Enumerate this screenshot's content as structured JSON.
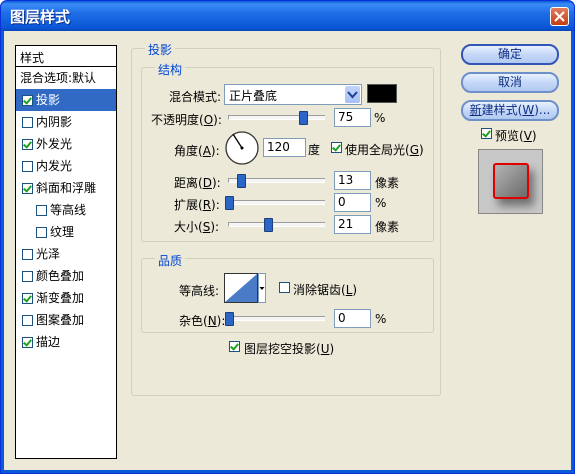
{
  "window": {
    "title": "图层样式"
  },
  "list": {
    "header": "样式",
    "blend_item": "混合选项:默认",
    "items": [
      {
        "label": "投影",
        "checked": true
      },
      {
        "label": "内阴影",
        "checked": false
      },
      {
        "label": "外发光",
        "checked": true
      },
      {
        "label": "内发光",
        "checked": false
      },
      {
        "label": "斜面和浮雕",
        "checked": true
      },
      {
        "label": "等高线",
        "checked": false
      },
      {
        "label": "纹理",
        "checked": false
      },
      {
        "label": "光泽",
        "checked": false
      },
      {
        "label": "颜色叠加",
        "checked": false
      },
      {
        "label": "渐变叠加",
        "checked": true
      },
      {
        "label": "图案叠加",
        "checked": false
      },
      {
        "label": "描边",
        "checked": true
      }
    ]
  },
  "drop_shadow": {
    "title": "投影",
    "structure": {
      "title": "结构",
      "blend_mode_label": "混合模式:",
      "blend_mode_value": "正片叠底",
      "blend_color": "#000000",
      "opacity_label": "不透明度(O):",
      "opacity_value": "75",
      "opacity_unit": "%",
      "opacity_level": 0.75,
      "angle_label": "角度(A):",
      "angle_value": "120",
      "angle_unit": "度",
      "global_light_label": "使用全局光(G)",
      "global_light_checked": true,
      "distance_label": "距离(D):",
      "distance_value": "13",
      "distance_unit": "像素",
      "spread_label": "扩展(R):",
      "spread_value": "0",
      "spread_unit": "%",
      "size_label": "大小(S):",
      "size_value": "21",
      "size_unit": "像素"
    },
    "quality": {
      "title": "品质",
      "contour_label": "等高线:",
      "antialias_label": "消除锯齿(L)",
      "antialias_checked": false,
      "noise_label": "杂色(N):",
      "noise_value": "0",
      "noise_unit": "%"
    },
    "knockout_label": "图层挖空投影(U)",
    "knockout_checked": true
  },
  "buttons": {
    "ok": "确定",
    "cancel": "取消",
    "new_style": "新建样式(W)..."
  },
  "preview": {
    "label": "预览(V)",
    "checked": true
  },
  "colors": {
    "title_bar": "#0a5ad8",
    "selection": "#316ac5",
    "group_title": "#0046d5",
    "preview_border": "#e00000"
  }
}
